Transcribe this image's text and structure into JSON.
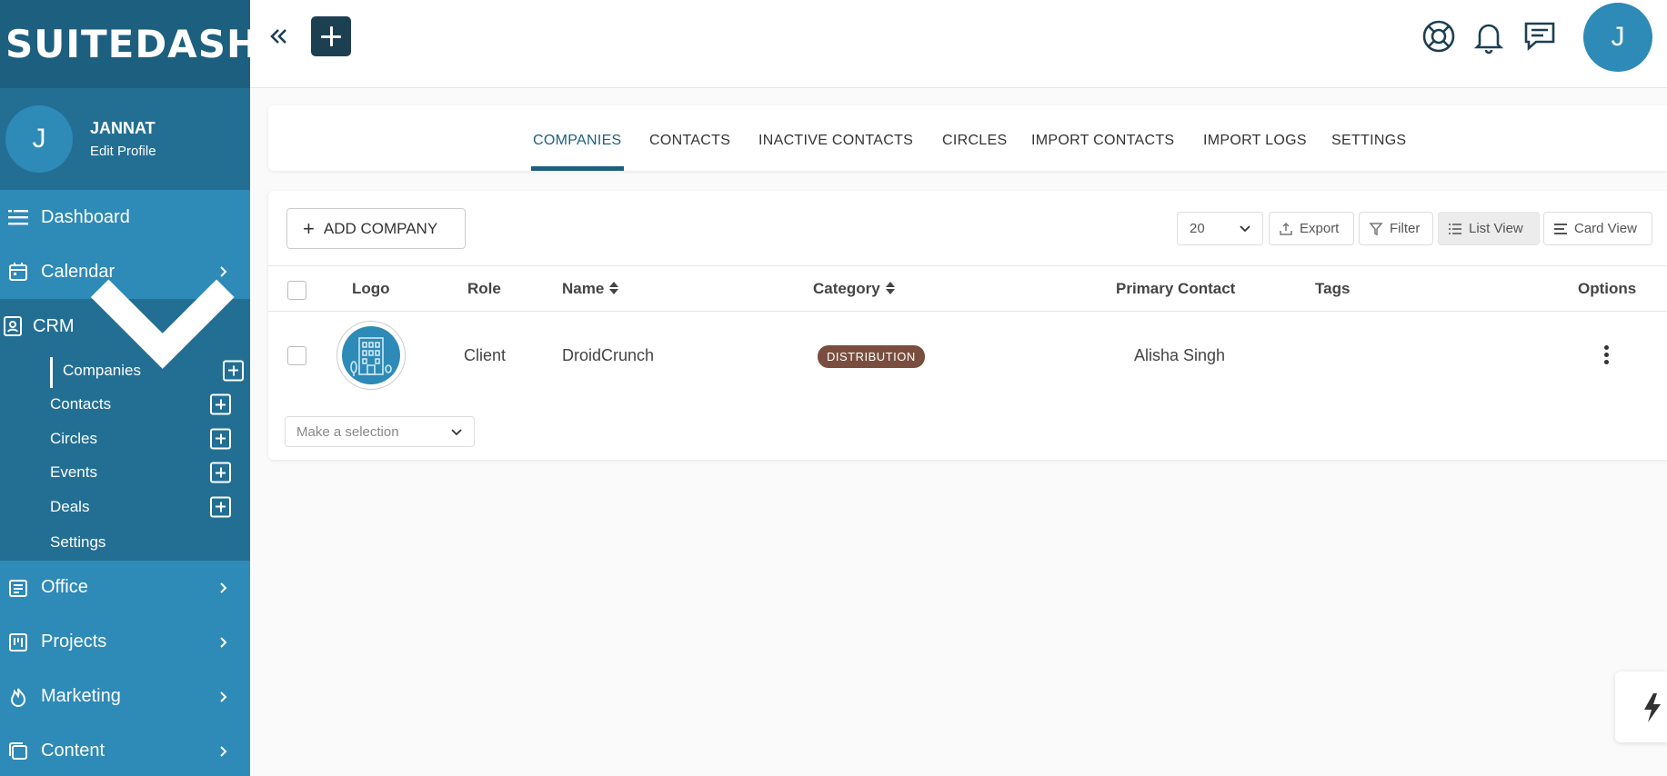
{
  "brand": {
    "logo_text": "SUITEDASH"
  },
  "profile": {
    "initial": "J",
    "name": "JANNAT",
    "edit_label": "Edit Profile"
  },
  "sidebar": {
    "top_items": [
      {
        "label": "Dashboard",
        "icon": "menu-lines-icon"
      },
      {
        "label": "Calendar",
        "icon": "calendar-icon"
      }
    ],
    "crm": {
      "label": "CRM",
      "icon": "address-book-icon",
      "subitems": [
        {
          "label": "Companies",
          "has_add": true,
          "active": true
        },
        {
          "label": "Contacts",
          "has_add": true
        },
        {
          "label": "Circles",
          "has_add": true
        },
        {
          "label": "Events",
          "has_add": true
        },
        {
          "label": "Deals",
          "has_add": true
        },
        {
          "label": "Settings",
          "has_add": false
        }
      ]
    },
    "bottom_items": [
      {
        "label": "Office",
        "icon": "office-icon"
      },
      {
        "label": "Projects",
        "icon": "kanban-icon"
      },
      {
        "label": "Marketing",
        "icon": "flame-icon"
      },
      {
        "label": "Content",
        "icon": "layers-icon"
      }
    ]
  },
  "topbar": {
    "avatar_initial": "J"
  },
  "tabs": [
    {
      "label": "COMPANIES",
      "active": true
    },
    {
      "label": "CONTACTS"
    },
    {
      "label": "INACTIVE CONTACTS"
    },
    {
      "label": "CIRCLES"
    },
    {
      "label": "IMPORT CONTACTS"
    },
    {
      "label": "IMPORT LOGS"
    },
    {
      "label": "SETTINGS"
    }
  ],
  "toolbar": {
    "add_company_label": "ADD COMPANY",
    "page_size": "20",
    "export_label": "Export",
    "filter_label": "Filter",
    "list_view_label": "List View",
    "card_view_label": "Card View"
  },
  "table": {
    "headers": {
      "logo": "Logo",
      "role": "Role",
      "name": "Name",
      "category": "Category",
      "primary_contact": "Primary Contact",
      "tags": "Tags",
      "options": "Options"
    },
    "rows": [
      {
        "role": "Client",
        "name": "DroidCrunch",
        "category": "DISTRIBUTION",
        "primary_contact": "Alisha Singh",
        "tags": ""
      }
    ]
  },
  "bulk_select": {
    "placeholder": "Make a selection"
  },
  "colors": {
    "sidebar": "#2e8ab7",
    "sidebar_dark": "#1d5f7e",
    "accent": "#1d3f52",
    "badge": "#7a4e3e"
  }
}
